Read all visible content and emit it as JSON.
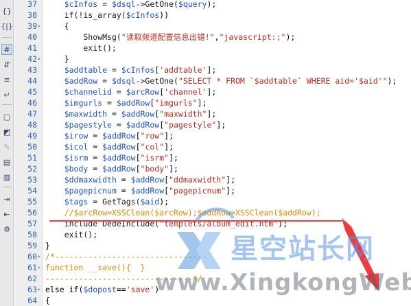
{
  "toolbar": {
    "buttons": [
      {
        "icon": "braces-icon",
        "glyph": "{}"
      },
      {
        "icon": "format-braces-icon",
        "glyph": "{|}"
      },
      {
        "icon": "highlight-code-icon",
        "glyph": "#"
      },
      {
        "icon": "collapse-icon",
        "glyph": "⇵"
      },
      {
        "icon": "line-numbers-icon",
        "glyph": "≡"
      },
      {
        "icon": "wrap-icon",
        "glyph": "↵"
      },
      {
        "icon": "comment-icon",
        "glyph": "▢"
      },
      {
        "icon": "uncomment-icon",
        "glyph": "◩"
      },
      {
        "icon": "brush-icon",
        "glyph": "✎"
      },
      {
        "icon": "recent-snippets-icon",
        "glyph": "▤"
      },
      {
        "icon": "move-css-icon",
        "glyph": "▥"
      },
      {
        "icon": "indent-icon",
        "glyph": "⇥"
      },
      {
        "icon": "outdent-icon",
        "glyph": "⇤"
      },
      {
        "icon": "format-source-icon",
        "glyph": "⚙"
      }
    ]
  },
  "gutter": {
    "line_numbers": [
      "37",
      "38",
      "39",
      "40",
      "41",
      "42",
      "43",
      "44",
      "45",
      "46",
      "47",
      "48",
      "49",
      "50",
      "51",
      "52",
      "53",
      "54",
      "55",
      "56",
      "57",
      "58",
      "59",
      "60",
      "61",
      "62",
      "63",
      "64"
    ]
  },
  "code": {
    "lines": [
      [
        {
          "t": "    ",
          "c": "pun"
        },
        {
          "t": "$cInfos",
          "c": "var"
        },
        {
          "t": " = ",
          "c": "pun"
        },
        {
          "t": "$dsql",
          "c": "var"
        },
        {
          "t": "->GetOne(",
          "c": "fn"
        },
        {
          "t": "$query",
          "c": "var"
        },
        {
          "t": ");",
          "c": "pun"
        }
      ],
      [
        {
          "t": "    if(!is_array(",
          "c": "fn"
        },
        {
          "t": "$cInfos",
          "c": "var"
        },
        {
          "t": "))",
          "c": "pun"
        }
      ],
      [
        {
          "t": "    {",
          "c": "pun"
        }
      ],
      [
        {
          "t": "        ShowMsg(",
          "c": "fn"
        },
        {
          "t": "\"读取频道配置信息出错!\"",
          "c": "str"
        },
        {
          "t": ",",
          "c": "pun"
        },
        {
          "t": "\"javascript:;\"",
          "c": "str"
        },
        {
          "t": ");",
          "c": "pun"
        }
      ],
      [
        {
          "t": "        exit();",
          "c": "fn"
        }
      ],
      [
        {
          "t": "    }",
          "c": "pun"
        }
      ],
      [
        {
          "t": "    ",
          "c": "pun"
        },
        {
          "t": "$addtable",
          "c": "var"
        },
        {
          "t": " = ",
          "c": "pun"
        },
        {
          "t": "$cInfos",
          "c": "var"
        },
        {
          "t": "[",
          "c": "pun"
        },
        {
          "t": "'addtable'",
          "c": "str"
        },
        {
          "t": "];",
          "c": "pun"
        }
      ],
      [
        {
          "t": "    ",
          "c": "pun"
        },
        {
          "t": "$addRow",
          "c": "var"
        },
        {
          "t": " = ",
          "c": "pun"
        },
        {
          "t": "$dsql",
          "c": "var"
        },
        {
          "t": "->GetOne(",
          "c": "fn"
        },
        {
          "t": "\"SELECT * FROM `$addtable` WHERE aid='$aid'\"",
          "c": "str"
        },
        {
          "t": ");",
          "c": "pun"
        }
      ],
      [
        {
          "t": "    ",
          "c": "pun"
        },
        {
          "t": "$channelid",
          "c": "var"
        },
        {
          "t": " = ",
          "c": "pun"
        },
        {
          "t": "$arcRow",
          "c": "var"
        },
        {
          "t": "[",
          "c": "pun"
        },
        {
          "t": "'channel'",
          "c": "str"
        },
        {
          "t": "];",
          "c": "pun"
        }
      ],
      [
        {
          "t": "    ",
          "c": "pun"
        },
        {
          "t": "$imgurls",
          "c": "var"
        },
        {
          "t": " = ",
          "c": "pun"
        },
        {
          "t": "$addRow",
          "c": "var"
        },
        {
          "t": "[",
          "c": "pun"
        },
        {
          "t": "\"imgurls\"",
          "c": "str"
        },
        {
          "t": "];",
          "c": "pun"
        }
      ],
      [
        {
          "t": "    ",
          "c": "pun"
        },
        {
          "t": "$maxwidth",
          "c": "var"
        },
        {
          "t": " = ",
          "c": "pun"
        },
        {
          "t": "$addRow",
          "c": "var"
        },
        {
          "t": "[",
          "c": "pun"
        },
        {
          "t": "\"maxwidth\"",
          "c": "str"
        },
        {
          "t": "];",
          "c": "pun"
        }
      ],
      [
        {
          "t": "    ",
          "c": "pun"
        },
        {
          "t": "$pagestyle",
          "c": "var"
        },
        {
          "t": " = ",
          "c": "pun"
        },
        {
          "t": "$addRow",
          "c": "var"
        },
        {
          "t": "[",
          "c": "pun"
        },
        {
          "t": "\"pagestyle\"",
          "c": "str"
        },
        {
          "t": "];",
          "c": "pun"
        }
      ],
      [
        {
          "t": "    ",
          "c": "pun"
        },
        {
          "t": "$irow",
          "c": "var"
        },
        {
          "t": " = ",
          "c": "pun"
        },
        {
          "t": "$addRow",
          "c": "var"
        },
        {
          "t": "[",
          "c": "pun"
        },
        {
          "t": "\"row\"",
          "c": "str"
        },
        {
          "t": "];",
          "c": "pun"
        }
      ],
      [
        {
          "t": "    ",
          "c": "pun"
        },
        {
          "t": "$icol",
          "c": "var"
        },
        {
          "t": " = ",
          "c": "pun"
        },
        {
          "t": "$addRow",
          "c": "var"
        },
        {
          "t": "[",
          "c": "pun"
        },
        {
          "t": "\"col\"",
          "c": "str"
        },
        {
          "t": "];",
          "c": "pun"
        }
      ],
      [
        {
          "t": "    ",
          "c": "pun"
        },
        {
          "t": "$isrm",
          "c": "var"
        },
        {
          "t": " = ",
          "c": "pun"
        },
        {
          "t": "$addRow",
          "c": "var"
        },
        {
          "t": "[",
          "c": "pun"
        },
        {
          "t": "\"isrm\"",
          "c": "str"
        },
        {
          "t": "];",
          "c": "pun"
        }
      ],
      [
        {
          "t": "    ",
          "c": "pun"
        },
        {
          "t": "$body",
          "c": "var"
        },
        {
          "t": " = ",
          "c": "pun"
        },
        {
          "t": "$addRow",
          "c": "var"
        },
        {
          "t": "[",
          "c": "pun"
        },
        {
          "t": "\"body\"",
          "c": "str"
        },
        {
          "t": "];",
          "c": "pun"
        }
      ],
      [
        {
          "t": "    ",
          "c": "pun"
        },
        {
          "t": "$ddmaxwidth",
          "c": "var"
        },
        {
          "t": " = ",
          "c": "pun"
        },
        {
          "t": "$addRow",
          "c": "var"
        },
        {
          "t": "[",
          "c": "pun"
        },
        {
          "t": "\"ddmaxwidth\"",
          "c": "str"
        },
        {
          "t": "];",
          "c": "pun"
        }
      ],
      [
        {
          "t": "    ",
          "c": "pun"
        },
        {
          "t": "$pagepicnum",
          "c": "var"
        },
        {
          "t": " = ",
          "c": "pun"
        },
        {
          "t": "$addRow",
          "c": "var"
        },
        {
          "t": "[",
          "c": "pun"
        },
        {
          "t": "\"pagepicnum\"",
          "c": "str"
        },
        {
          "t": "];",
          "c": "pun"
        }
      ],
      [
        {
          "t": "    ",
          "c": "pun"
        },
        {
          "t": "$tags",
          "c": "var"
        },
        {
          "t": " = GetTags(",
          "c": "fn"
        },
        {
          "t": "$aid",
          "c": "var"
        },
        {
          "t": ");",
          "c": "pun"
        }
      ],
      [
        {
          "t": "    //$arcRow=XSSClean($arcRow);$addRow=XSSClean($addRow);",
          "c": "cmt"
        }
      ],
      [
        {
          "t": "    include DedeInclude(",
          "c": "fn"
        },
        {
          "t": "\"templets/album_edit.htm\"",
          "c": "str"
        },
        {
          "t": ");",
          "c": "pun"
        }
      ],
      [
        {
          "t": "    exit();",
          "c": "fn"
        }
      ],
      [
        {
          "t": "}",
          "c": "pun"
        }
      ],
      [
        {
          "t": "/*--------------------------------",
          "c": "cmt"
        }
      ],
      [
        {
          "t": "function __save(){  }",
          "c": "cmt"
        }
      ],
      [
        {
          "t": "-------------------------------*/",
          "c": "cmt"
        }
      ],
      [
        {
          "t": "else if(",
          "c": "kw"
        },
        {
          "t": "$dopost",
          "c": "var"
        },
        {
          "t": "==",
          "c": "pun"
        },
        {
          "t": "'save'",
          "c": "str"
        },
        {
          "t": ")",
          "c": "pun"
        }
      ],
      [
        {
          "t": "{",
          "c": "pun"
        }
      ]
    ]
  },
  "watermark": {
    "cn": "星空站长网",
    "en": "www.XingkongWeb.com"
  },
  "colors": {
    "variable": "#1e50c8",
    "string": "#c0281c",
    "comment": "#e08a00",
    "line_number": "#2a62c9",
    "annotation": "#ef3b3b"
  }
}
